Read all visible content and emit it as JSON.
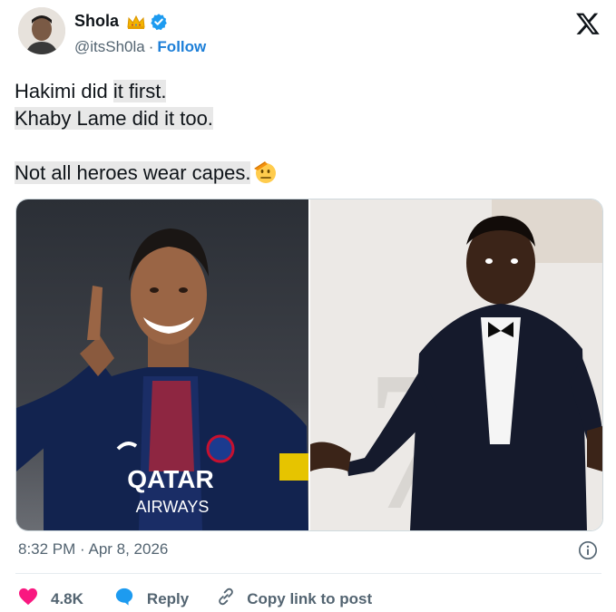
{
  "author": {
    "name": "Shola",
    "handle": "@itsSh0la",
    "follow_label": "Follow",
    "separator": "·"
  },
  "tweet": {
    "line1_a": "Hakimi did ",
    "line1_b": "it first.",
    "line2": "Khaby Lame did it too.",
    "line3": "Not all heroes wear capes."
  },
  "media": {
    "left_jersey_line1": "QATAR",
    "left_jersey_line2": "AIRWAYS",
    "right_bg_number": "7"
  },
  "footer": {
    "timestamp": "8:32 PM · Apr 8, 2026",
    "likes": "4.8K",
    "reply_label": "Reply",
    "copy_label": "Copy link to post"
  },
  "colors": {
    "brand_blue": "#1d9bf0",
    "like_red": "#f91880",
    "secondary_text": "#536471"
  },
  "icons": [
    "crown-icon",
    "verified-badge-icon",
    "x-logo-icon",
    "info-icon",
    "heart-icon",
    "reply-bubble-icon",
    "link-icon",
    "salute-emoji-icon"
  ]
}
